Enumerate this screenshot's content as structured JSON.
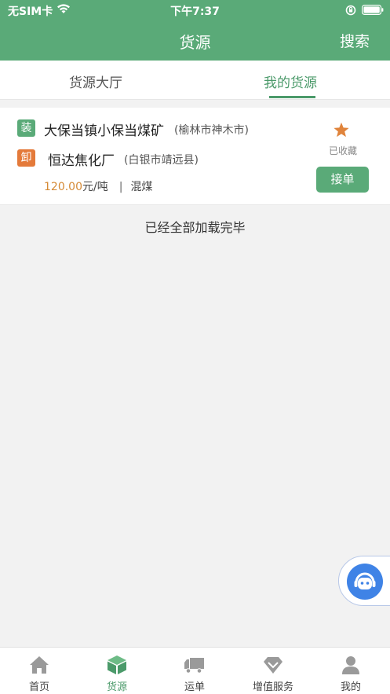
{
  "status_bar": {
    "carrier": "无SIM卡",
    "time": "下午7:37",
    "icons": [
      "wifi-icon",
      "rotation-lock-icon",
      "battery-icon"
    ]
  },
  "nav": {
    "title": "货源",
    "search_label": "搜索"
  },
  "tabs": {
    "items": [
      {
        "label": "货源大厅",
        "active": false
      },
      {
        "label": "我的货源",
        "active": true
      }
    ]
  },
  "listing": {
    "load_badge": "装",
    "origin_name": "大保当镇小保当煤矿",
    "origin_region": "(榆林市神木市)",
    "unload_badge": "卸",
    "dest_name": "恒达焦化厂",
    "dest_region": "(白银市靖远县)",
    "price": "120.00",
    "price_unit": "元/吨",
    "separator": "|",
    "cargo_type": "混煤",
    "favorite_label": "已收藏",
    "accept_label": "接单"
  },
  "list_footer": "已经全部加载完毕",
  "tabbar": {
    "items": [
      {
        "label": "首页",
        "icon": "home-icon",
        "active": false
      },
      {
        "label": "货源",
        "icon": "cargo-box-icon",
        "active": true
      },
      {
        "label": "运单",
        "icon": "truck-icon",
        "active": false
      },
      {
        "label": "增值服务",
        "icon": "diamond-icon",
        "active": false
      },
      {
        "label": "我的",
        "icon": "person-icon",
        "active": false
      }
    ]
  },
  "colors": {
    "brand_green": "#5aaa78",
    "accent_orange": "#e47a3a",
    "price_orange": "#d58a36",
    "service_blue": "#3f83e6"
  }
}
